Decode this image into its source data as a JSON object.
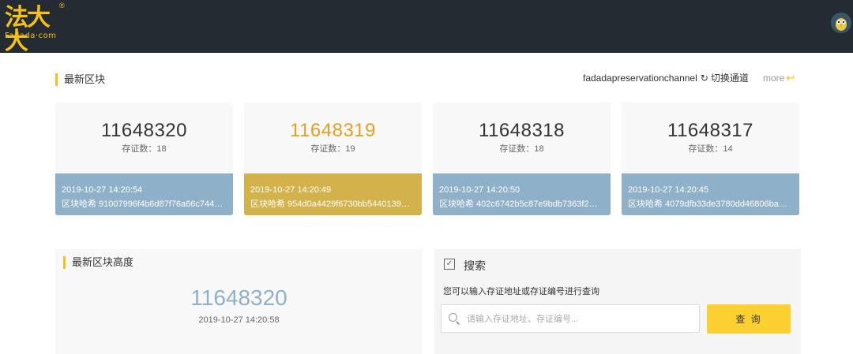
{
  "header": {
    "logo_main": "法大大",
    "logo_sub": "Fadada·com",
    "logo_reg": "®"
  },
  "latest_blocks": {
    "title": "最新区块",
    "channel": "fadadapreservationchannel",
    "switch_label": "切换通道",
    "more_label": "more",
    "cards": [
      {
        "number": "11648320",
        "count_label": "存证数：18",
        "time": "2019-10-27 14:20:54",
        "hash": "区块哈希 91007996f4b6d87f76a66c744…",
        "active": false
      },
      {
        "number": "11648319",
        "count_label": "存证数：19",
        "time": "2019-10-27 14:20:49",
        "hash": "区块哈希 954d0a4429f6730bb5440139…",
        "active": true
      },
      {
        "number": "11648318",
        "count_label": "存证数：18",
        "time": "2019-10-27 14:20:50",
        "hash": "区块哈希 402c6742b5c87e9bdb7363f2…",
        "active": false
      },
      {
        "number": "11648317",
        "count_label": "存证数：14",
        "time": "2019-10-27 14:20:45",
        "hash": "区块哈希 4079dfb33de3780dd46806ba…",
        "active": false
      }
    ]
  },
  "latest_height": {
    "title": "最新区块高度",
    "value": "11648320",
    "time": "2019-10-27 14:20:58"
  },
  "search": {
    "title": "搜索",
    "hint": "您可以输入存证地址或存证编号进行查询",
    "placeholder": "请输入存证地址、存证编号...",
    "button": "查 询"
  },
  "colors": {
    "header_bg": "#252b33",
    "accent_yellow": "#f5c118",
    "card_blue": "#8fb0c9",
    "card_gold": "#d3b24c"
  }
}
